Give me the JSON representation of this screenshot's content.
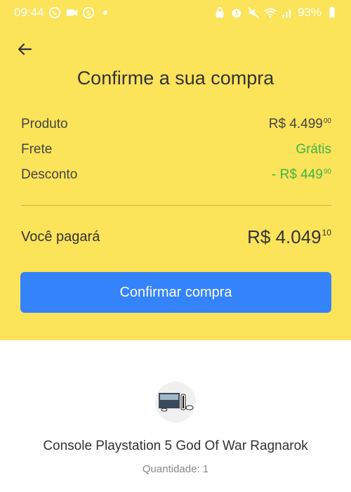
{
  "status_bar": {
    "time": "09:44",
    "battery": "93%"
  },
  "header": {
    "title": "Confirme a sua compra"
  },
  "summary": {
    "product": {
      "label": "Produto",
      "amount": "R$ 4.499",
      "cents": "00"
    },
    "shipping": {
      "label": "Frete",
      "amount": "Grátis"
    },
    "discount": {
      "label": "Desconto",
      "amount": "- R$ 449",
      "cents": "90"
    },
    "total": {
      "label": "Você pagará",
      "amount": "R$ 4.049",
      "cents": "10"
    }
  },
  "actions": {
    "confirm_label": "Confirmar compra"
  },
  "product": {
    "name": "Console Playstation 5 God Of War Ragnarok",
    "quantity": "Quantidade: 1"
  },
  "colors": {
    "header_bg": "#fbe35a",
    "accent_blue": "#3483fa",
    "success_green": "#3fb446"
  },
  "icons": {
    "back": "arrow-left-icon",
    "whatsapp": "whatsapp-icon",
    "video": "video-icon",
    "dollar": "dollar-icon",
    "wifi": "wifi-icon",
    "signal": "signal-icon",
    "battery": "battery-icon"
  }
}
